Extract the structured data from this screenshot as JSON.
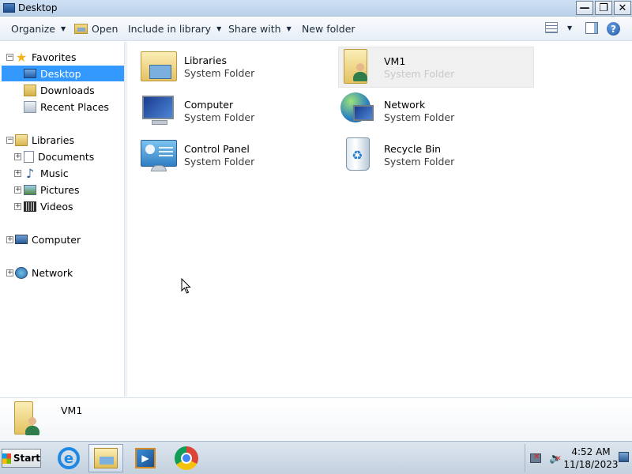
{
  "window": {
    "title": "Desktop",
    "minimize_glyph": "—",
    "restore_glyph": "❐",
    "close_glyph": "✕"
  },
  "command_bar": {
    "organize": "Organize",
    "open": "Open",
    "include_in_library": "Include in library",
    "share_with": "Share with",
    "new_folder": "New folder",
    "dropdown_glyph": "▼",
    "help_glyph": "?"
  },
  "navigation": {
    "favorites": {
      "label": "Favorites",
      "items": [
        {
          "label": "Desktop",
          "icon": "desktop-icon",
          "selected": true
        },
        {
          "label": "Downloads",
          "icon": "downloads-icon"
        },
        {
          "label": "Recent Places",
          "icon": "recent-places-icon"
        }
      ]
    },
    "libraries": {
      "label": "Libraries",
      "items": [
        {
          "label": "Documents",
          "icon": "documents-icon"
        },
        {
          "label": "Music",
          "icon": "music-icon"
        },
        {
          "label": "Pictures",
          "icon": "pictures-icon"
        },
        {
          "label": "Videos",
          "icon": "videos-icon"
        }
      ]
    },
    "computer": {
      "label": "Computer"
    },
    "network": {
      "label": "Network"
    },
    "collapse_glyph": "−",
    "expand_glyph": "+"
  },
  "content": {
    "items": [
      {
        "name": "Libraries",
        "type": "System Folder",
        "icon": "libraries-icon"
      },
      {
        "name": "VM1",
        "type": "System Folder",
        "icon": "user-folder-icon",
        "hovered": true
      },
      {
        "name": "Computer",
        "type": "System Folder",
        "icon": "computer-icon"
      },
      {
        "name": "Network",
        "type": "System Folder",
        "icon": "network-icon"
      },
      {
        "name": "Control Panel",
        "type": "System Folder",
        "icon": "control-panel-icon"
      },
      {
        "name": "Recycle Bin",
        "type": "System Folder",
        "icon": "recycle-bin-icon"
      }
    ]
  },
  "details": {
    "name": "VM1"
  },
  "taskbar": {
    "start_label": "Start",
    "ie_glyph": "e",
    "wmp_glyph": "▶",
    "clock_time": "4:52 AM",
    "clock_date": "11/18/2023",
    "volume_glyph": "🔈"
  }
}
